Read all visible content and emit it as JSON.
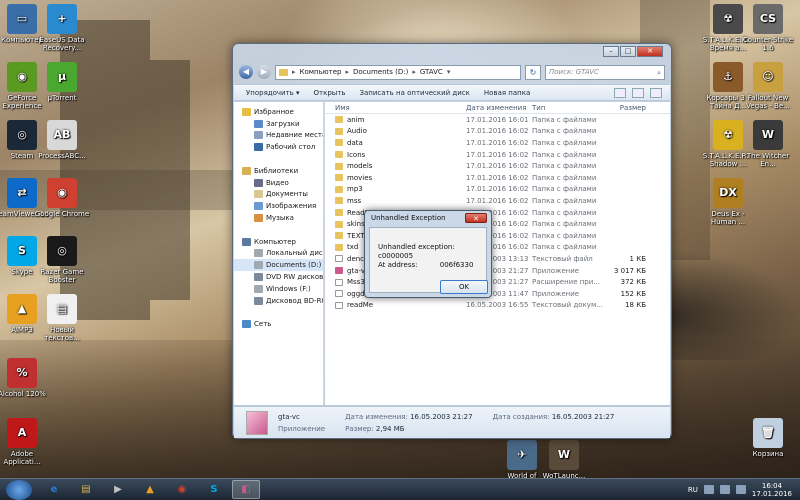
{
  "desktop": {
    "icons_left": [
      {
        "label": "Компьютер",
        "color": "#3a6ea8",
        "glyph": "▭"
      },
      {
        "label": "EaseUS Data Recovery...",
        "color": "#2a8ad0",
        "glyph": "+"
      },
      {
        "label": "GeForce Experience",
        "color": "#5a9a20",
        "glyph": "◉"
      },
      {
        "label": "µTorrent",
        "color": "#4aa830",
        "glyph": "µ"
      },
      {
        "label": "Steam",
        "color": "#1b2838",
        "glyph": "◎"
      },
      {
        "label": "ProcessABC...",
        "color": "#d8d8d8",
        "glyph": "AB"
      },
      {
        "label": "TeamViewer 10",
        "color": "#0e6ac8",
        "glyph": "⇄"
      },
      {
        "label": "Google Chrome",
        "color": "#d04030",
        "glyph": "◉"
      },
      {
        "label": "Skype",
        "color": "#00a8e8",
        "glyph": "S"
      },
      {
        "label": "Razer Game Booster",
        "color": "#1a1a1a",
        "glyph": "◎"
      },
      {
        "label": "AIMP3",
        "color": "#e8a020",
        "glyph": "▲"
      },
      {
        "label": "Новый текстов...",
        "color": "#f0f0f0",
        "glyph": "▤"
      },
      {
        "label": "Alcohol 120%",
        "color": "#c03030",
        "glyph": "%"
      },
      {
        "label": "Adobe Applicati...",
        "color": "#c01818",
        "glyph": "A"
      }
    ],
    "icons_right": [
      {
        "label": "S.T.A.L.K.E.R. - Время а...",
        "color": "#4a4a4a",
        "glyph": "☢"
      },
      {
        "label": "Counter-Strike 1.6",
        "color": "#6a6a6a",
        "glyph": "CS"
      },
      {
        "label": "Корсары 3 - Тайна Д...",
        "color": "#8a5a2a",
        "glyph": "⚓"
      },
      {
        "label": "Fallout New Vegas - Ве...",
        "color": "#c8a040",
        "glyph": "☺"
      },
      {
        "label": "S.T.A.L.K.E.R. - Shadow ...",
        "color": "#d8b020",
        "glyph": "☢"
      },
      {
        "label": "The Witcher En...",
        "color": "#3a3a3a",
        "glyph": "W"
      },
      {
        "label": "Deus Ex - Human ...",
        "color": "#b08020",
        "glyph": "DX"
      },
      {
        "label": "Корзина",
        "color": "#c0d0e0",
        "glyph": "🗑"
      }
    ],
    "icons_bottom": [
      {
        "label": "World of Warplanes",
        "color": "#4a6a8a",
        "glyph": "✈"
      },
      {
        "label": "WoTLaunc...",
        "color": "#5a4a3a",
        "glyph": "W"
      }
    ]
  },
  "explorer": {
    "breadcrumb": [
      "Компьютер",
      "Documents (D:)",
      "GTAVC"
    ],
    "search_placeholder": "Поиск: GTAVC",
    "toolbar": {
      "organize": "Упорядочить ▾",
      "open": "Открыть",
      "burn": "Записать на оптический диск",
      "new_folder": "Новая папка"
    },
    "nav": [
      {
        "label": "Избранное",
        "color": "#e8c040",
        "indent": 0
      },
      {
        "label": "Загрузки",
        "color": "#5a8ac8",
        "indent": 1
      },
      {
        "label": "Недавние места",
        "color": "#8aa0c0",
        "indent": 1
      },
      {
        "label": "Рабочий стол",
        "color": "#3a6aa8",
        "indent": 1
      },
      {
        "label": "",
        "color": "transparent",
        "indent": 0
      },
      {
        "label": "Библиотеки",
        "color": "#d8b050",
        "indent": 0
      },
      {
        "label": "Видео",
        "color": "#6a6a8a",
        "indent": 1
      },
      {
        "label": "Документы",
        "color": "#d8c890",
        "indent": 1
      },
      {
        "label": "Изображения",
        "color": "#6a9ad0",
        "indent": 1
      },
      {
        "label": "Музыка",
        "color": "#d89040",
        "indent": 1
      },
      {
        "label": "",
        "color": "transparent",
        "indent": 0
      },
      {
        "label": "Компьютер",
        "color": "#5a7aa0",
        "indent": 0
      },
      {
        "label": "Локальный диск (C",
        "color": "#a0a8b0",
        "indent": 1
      },
      {
        "label": "Documents (D:)",
        "color": "#a0a8b0",
        "indent": 1,
        "selected": true
      },
      {
        "label": "DVD RW дисковод (",
        "color": "#7a8a9a",
        "indent": 1
      },
      {
        "label": "Windows (F:)",
        "color": "#a0a8b0",
        "indent": 1
      },
      {
        "label": "Дисковод BD-ROM",
        "color": "#7a8a9a",
        "indent": 1
      },
      {
        "label": "",
        "color": "transparent",
        "indent": 0
      },
      {
        "label": "Сеть",
        "color": "#4a8ac8",
        "indent": 0
      }
    ],
    "columns": {
      "name": "Имя",
      "date": "Дата изменения",
      "type": "Тип",
      "size": "Размер"
    },
    "files": [
      {
        "name": "anim",
        "date": "17.01.2016 16:01",
        "type": "Папка с файлами",
        "size": "",
        "kind": "folder"
      },
      {
        "name": "Audio",
        "date": "17.01.2016 16:02",
        "type": "Папка с файлами",
        "size": "",
        "kind": "folder"
      },
      {
        "name": "data",
        "date": "17.01.2016 16:02",
        "type": "Папка с файлами",
        "size": "",
        "kind": "folder"
      },
      {
        "name": "Icons",
        "date": "17.01.2016 16:02",
        "type": "Папка с файлами",
        "size": "",
        "kind": "folder"
      },
      {
        "name": "models",
        "date": "17.01.2016 16:02",
        "type": "Папка с файлами",
        "size": "",
        "kind": "folder"
      },
      {
        "name": "movies",
        "date": "17.01.2016 16:02",
        "type": "Папка с файлами",
        "size": "",
        "kind": "folder"
      },
      {
        "name": "mp3",
        "date": "17.01.2016 16:02",
        "type": "Папка с файлами",
        "size": "",
        "kind": "folder"
      },
      {
        "name": "mss",
        "date": "17.01.2016 16:02",
        "type": "Папка с файлами",
        "size": "",
        "kind": "folder"
      },
      {
        "name": "ReadM",
        "date": "17.01.2016 16:02",
        "type": "Папка с файлами",
        "size": "",
        "kind": "folder"
      },
      {
        "name": "skins",
        "date": "17.01.2016 16:02",
        "type": "Папка с файлами",
        "size": "",
        "kind": "folder"
      },
      {
        "name": "TEXT",
        "date": "17.01.2016 16:02",
        "type": "Папка с файлами",
        "size": "",
        "kind": "folder"
      },
      {
        "name": "txd",
        "date": "17.01.2016 16:02",
        "type": "Папка с файлами",
        "size": "",
        "kind": "folder"
      },
      {
        "name": "denc",
        "date": "16.05.2003 13:13",
        "type": "Текстовый файл",
        "size": "1 КБ",
        "kind": "file"
      },
      {
        "name": "gta-vc",
        "date": "16.05.2003 21:27",
        "type": "Приложение",
        "size": "3 017 КБ",
        "kind": "app"
      },
      {
        "name": "Mss32",
        "date": "16.05.2003 21:27",
        "type": "Расширение при...",
        "size": "372 КБ",
        "kind": "file"
      },
      {
        "name": "oggde",
        "date": "16.05.2003 11:47",
        "type": "Приложение",
        "size": "152 КБ",
        "kind": "file"
      },
      {
        "name": "readMe",
        "date": "16.05.2003 16:55",
        "type": "Текстовый докум...",
        "size": "18 КБ",
        "kind": "file"
      }
    ],
    "details": {
      "name": "gta-vc",
      "kind": "Приложение",
      "modified_label": "Дата изменения:",
      "modified": "16.05.2003 21:27",
      "size_label": "Размер:",
      "size": "2,94 МБ",
      "created_label": "Дата создания:",
      "created": "16.05.2003 21:27"
    }
  },
  "dialog": {
    "title": "Unhandled Exception",
    "close": "✕",
    "line1": "Unhandled exception: c0000005",
    "line2_label": "At address:",
    "line2_value": "006f6330",
    "ok": "OK"
  },
  "taskbar": {
    "apps": [
      {
        "glyph": "e",
        "color": "#2a7ad0"
      },
      {
        "glyph": "▤",
        "color": "#d8b050"
      },
      {
        "glyph": "▶",
        "color": "#c0c0c0"
      },
      {
        "glyph": "▲",
        "color": "#e8a020"
      },
      {
        "glyph": "◉",
        "color": "#d04030"
      },
      {
        "glyph": "S",
        "color": "#00a8e8"
      },
      {
        "glyph": "◧",
        "color": "#c85a8c",
        "active": true
      }
    ],
    "lang": "RU",
    "time": "16:04",
    "date": "17.01.2016"
  }
}
